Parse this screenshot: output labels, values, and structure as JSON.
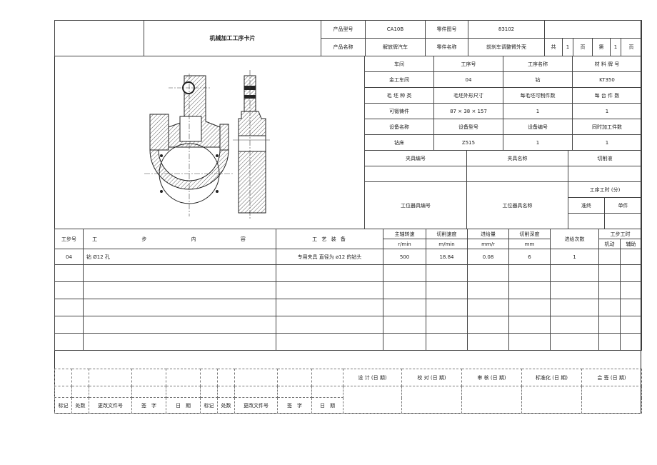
{
  "header": {
    "card_title": "机械加工工序卡片",
    "product_model_label": "产品型号",
    "product_model": "CA10B",
    "part_no_label": "零件图号",
    "part_no": "83102",
    "product_name_label": "产品名称",
    "product_name": "解放牌汽车",
    "part_name_label": "零件名称",
    "part_name": "前刹车调整臂外壳",
    "total_label": "共",
    "total_pages": "1",
    "page_unit": "页",
    "current_label": "第",
    "current_page": "1",
    "page_unit2": "页"
  },
  "info": {
    "rows": [
      [
        "车间",
        "工序号",
        "工序名称",
        "材 料 牌 号"
      ],
      [
        "金工车间",
        "04",
        "钻",
        "KT350"
      ],
      [
        "毛 坯 种 类",
        "毛坯外形尺寸",
        "每毛坯可制件数",
        "每 台 件 数"
      ],
      [
        "可锻铸件",
        "87 × 38 × 157",
        "1",
        "1"
      ],
      [
        "设备名称",
        "设备型号",
        "设备编号",
        "同时加工件数"
      ],
      [
        "钻床",
        "Z515",
        "1",
        "1"
      ]
    ],
    "fixture_no_label": "夹具编号",
    "fixture_name_label": "夹具名称",
    "coolant_label": "切削液",
    "station_tool_no_label": "工位器具编号",
    "station_tool_name_label": "工位器具名称",
    "op_time_label": "工序工时 (分)",
    "prep_end_label": "准终",
    "unit_label": "单件"
  },
  "steps": {
    "step_no_label": "工步号",
    "content_label": "工 步 内 容",
    "equipment_label": "工 艺 装 备",
    "spindle_label": "主轴转速",
    "spindle_unit": "r/min",
    "cut_speed_label": "切削速度",
    "cut_speed_unit": "m/min",
    "feed_label": "进给量",
    "feed_unit": "mm/r",
    "depth_label": "切削深度",
    "depth_unit": "mm",
    "passes_label": "进给次数",
    "step_time_label": "工步工时",
    "machine_label": "机动",
    "aux_label": "辅助",
    "row": {
      "no": "04",
      "content": "钻 Ø12 孔",
      "equipment": "专用夹具 直径为 ø12 的钻头",
      "spindle": "500",
      "cut_speed": "18.84",
      "feed": "0.08",
      "depth": "6",
      "passes": "1"
    }
  },
  "footer": {
    "design": "设 计 (日 期)",
    "check": "校 对 (日 期)",
    "review": "审 核 (日 期)",
    "standard": "标准化 (日 期)",
    "countersign": "会 签 (日 期)",
    "mark": "标记",
    "count": "处数",
    "change_doc": "更改文件号",
    "sign": "签　字",
    "date": "日　期"
  }
}
